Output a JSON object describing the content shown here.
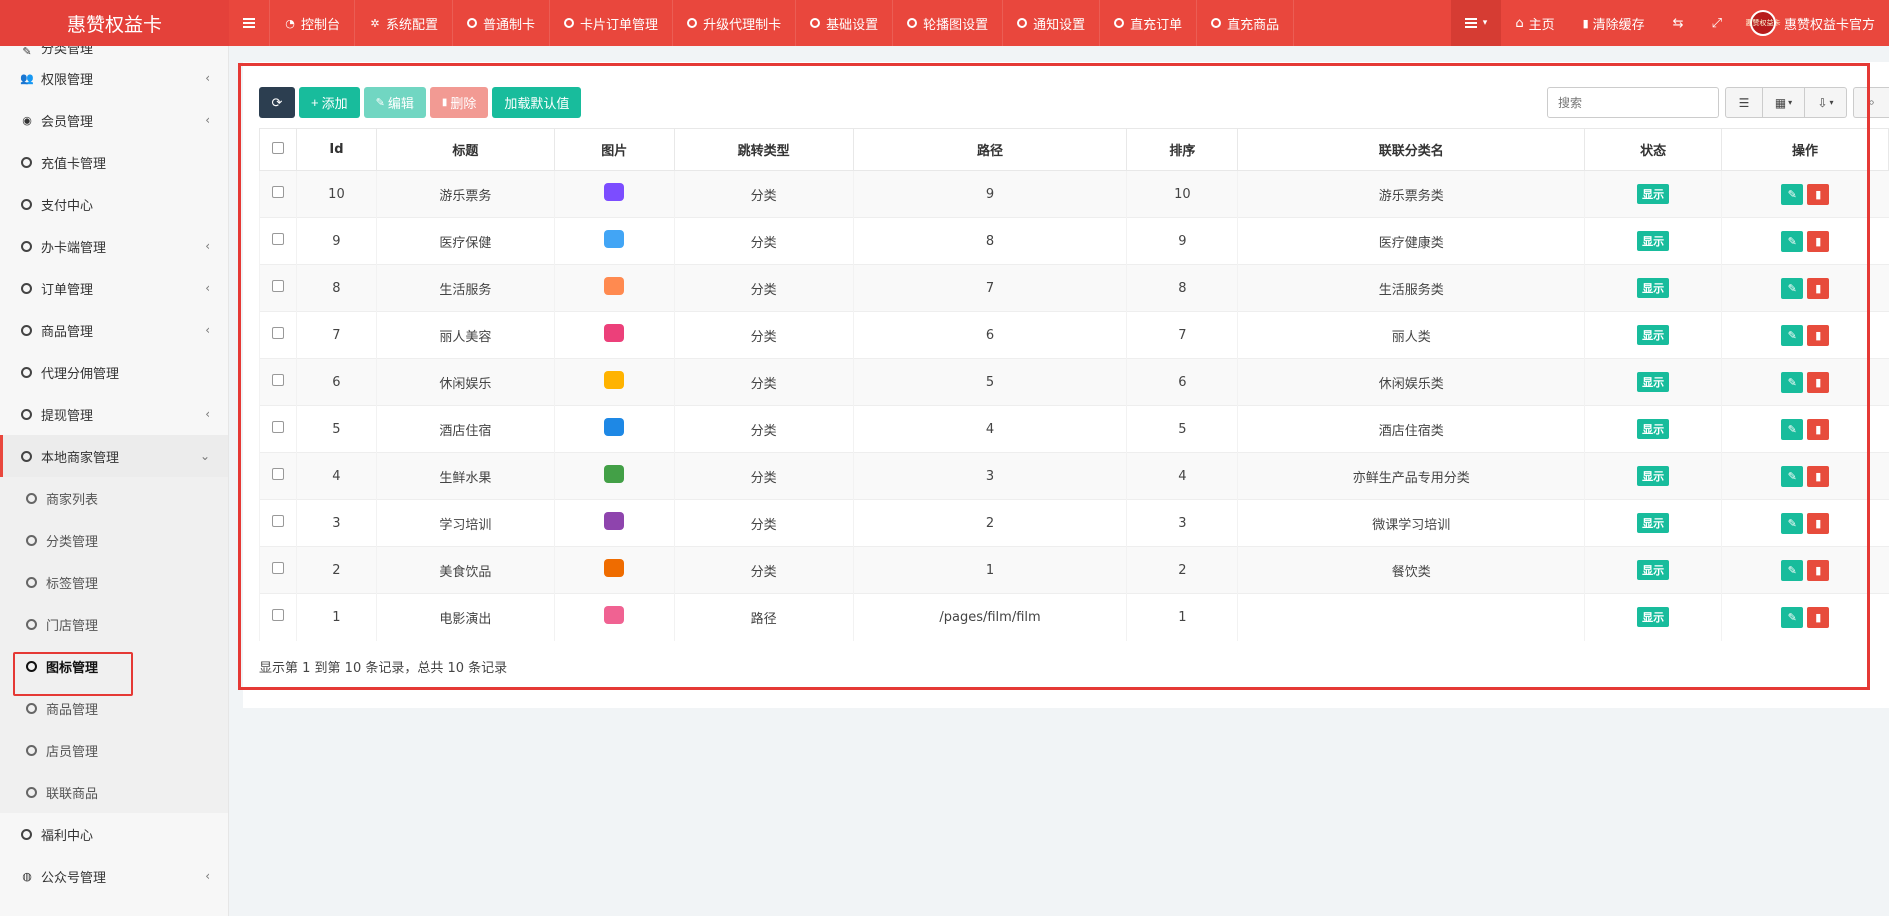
{
  "brand": {
    "title": "惠赞权益卡"
  },
  "topnav": [
    {
      "label": "控制台",
      "icon": "dashboard-icon"
    },
    {
      "label": "系统配置",
      "icon": "gear-icon"
    },
    {
      "label": "普通制卡",
      "icon": "circle-icon"
    },
    {
      "label": "卡片订单管理",
      "icon": "circle-icon"
    },
    {
      "label": "升级代理制卡",
      "icon": "circle-icon"
    },
    {
      "label": "基础设置",
      "icon": "circle-icon"
    },
    {
      "label": "轮播图设置",
      "icon": "circle-icon"
    },
    {
      "label": "通知设置",
      "icon": "circle-icon"
    },
    {
      "label": "直充订单",
      "icon": "circle-icon"
    },
    {
      "label": "直充商品",
      "icon": "circle-icon"
    }
  ],
  "topright": {
    "home": "主页",
    "clear_cache": "清除缓存",
    "user": "惠赞权益卡官方",
    "avatar_text": "惠赞权益卡"
  },
  "sidebar": {
    "partial_top": "分类管理",
    "items": [
      {
        "label": "权限管理",
        "icon": "users-icon",
        "arrow": "‹"
      },
      {
        "label": "会员管理",
        "icon": "user-icon",
        "arrow": "‹"
      },
      {
        "label": "充值卡管理",
        "icon": "circle-icon",
        "arrow": ""
      },
      {
        "label": "支付中心",
        "icon": "circle-icon",
        "arrow": ""
      },
      {
        "label": "办卡端管理",
        "icon": "circle-icon",
        "arrow": "‹"
      },
      {
        "label": "订单管理",
        "icon": "circle-icon",
        "arrow": "‹"
      },
      {
        "label": "商品管理",
        "icon": "circle-icon",
        "arrow": "‹"
      },
      {
        "label": "代理分佣管理",
        "icon": "circle-icon",
        "arrow": ""
      },
      {
        "label": "提现管理",
        "icon": "circle-icon",
        "arrow": "‹"
      }
    ],
    "open_group": {
      "label": "本地商家管理",
      "arrow": "⌄"
    },
    "sub_items": [
      "商家列表",
      "分类管理",
      "标签管理",
      "门店管理",
      "图标管理",
      "商品管理",
      "店员管理",
      "联联商品"
    ],
    "active_sub": "图标管理",
    "bottom_items": [
      {
        "label": "福利中心",
        "icon": "circle-icon",
        "arrow": ""
      },
      {
        "label": "公众号管理",
        "icon": "wechat-icon",
        "arrow": "‹"
      }
    ]
  },
  "toolbar": {
    "add": "添加",
    "edit": "编辑",
    "delete": "删除",
    "load_default": "加载默认值"
  },
  "search": {
    "placeholder": "搜索"
  },
  "table": {
    "columns": [
      "Id",
      "标题",
      "图片",
      "跳转类型",
      "路径",
      "排序",
      "联联分类名",
      "状态",
      "操作"
    ],
    "rows": [
      {
        "id": "10",
        "title": "游乐票务",
        "icon_color": "#7c4dff",
        "type": "分类",
        "path": "9",
        "sort": "10",
        "cat": "游乐票务类",
        "status": "显示"
      },
      {
        "id": "9",
        "title": "医疗保健",
        "icon_color": "#42a5f5",
        "type": "分类",
        "path": "8",
        "sort": "9",
        "cat": "医疗健康类",
        "status": "显示"
      },
      {
        "id": "8",
        "title": "生活服务",
        "icon_color": "#ff8a50",
        "type": "分类",
        "path": "7",
        "sort": "8",
        "cat": "生活服务类",
        "status": "显示"
      },
      {
        "id": "7",
        "title": "丽人美容",
        "icon_color": "#ec407a",
        "type": "分类",
        "path": "6",
        "sort": "7",
        "cat": "丽人类",
        "status": "显示"
      },
      {
        "id": "6",
        "title": "休闲娱乐",
        "icon_color": "#ffb300",
        "type": "分类",
        "path": "5",
        "sort": "6",
        "cat": "休闲娱乐类",
        "status": "显示"
      },
      {
        "id": "5",
        "title": "酒店住宿",
        "icon_color": "#1e88e5",
        "type": "分类",
        "path": "4",
        "sort": "5",
        "cat": "酒店住宿类",
        "status": "显示"
      },
      {
        "id": "4",
        "title": "生鲜水果",
        "icon_color": "#43a047",
        "type": "分类",
        "path": "3",
        "sort": "4",
        "cat": "亦鲜生产品专用分类",
        "status": "显示"
      },
      {
        "id": "3",
        "title": "学习培训",
        "icon_color": "#8e44ad",
        "type": "分类",
        "path": "2",
        "sort": "3",
        "cat": "微课学习培训",
        "status": "显示"
      },
      {
        "id": "2",
        "title": "美食饮品",
        "icon_color": "#ef6c00",
        "type": "分类",
        "path": "1",
        "sort": "2",
        "cat": "餐饮类",
        "status": "显示"
      },
      {
        "id": "1",
        "title": "电影演出",
        "icon_color": "#f06292",
        "type": "路径",
        "path": "/pages/film/film",
        "sort": "1",
        "cat": "",
        "status": "显示"
      }
    ]
  },
  "pagination": {
    "info": "显示第 1 到第 10 条记录，总共 10 条记录"
  },
  "colors": {
    "brand_red": "#e9473d",
    "green": "#18bc9c",
    "danger": "#e74c3c",
    "highlight": "#e53935"
  }
}
